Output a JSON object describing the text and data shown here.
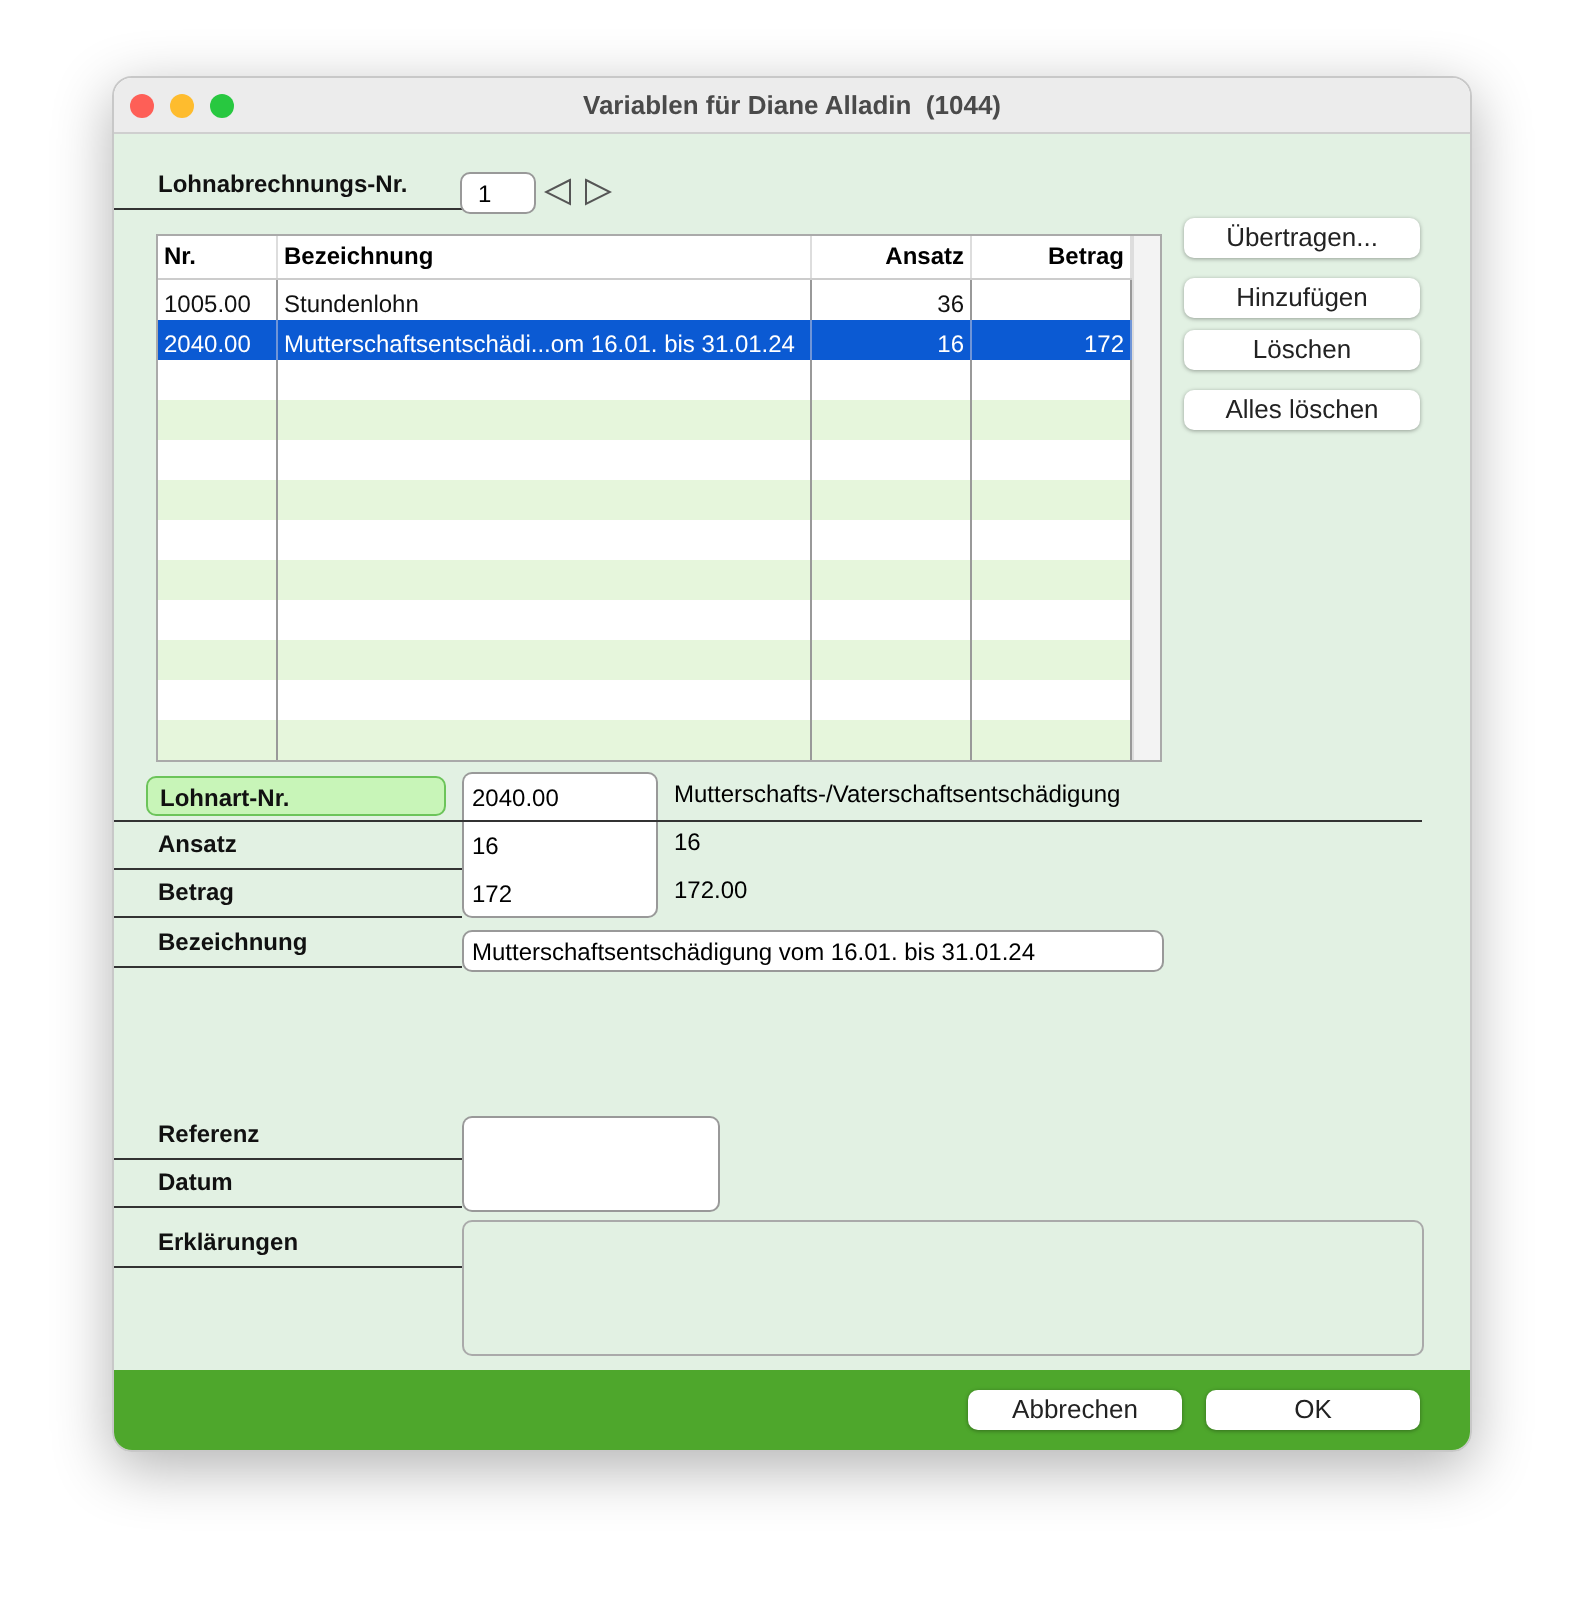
{
  "window": {
    "title": "Variablen für Diane Alladin  (1044)"
  },
  "payroll_number": {
    "label": "Lohnabrechnungs-Nr.",
    "value": "1"
  },
  "table": {
    "columns": [
      "Nr.",
      "Bezeichnung",
      "Ansatz",
      "Betrag"
    ],
    "rows": [
      {
        "cells": [
          "1005.00",
          "Stundenlohn",
          "36",
          ""
        ],
        "selected": false
      },
      {
        "cells": [
          "2040.00",
          "Mutterschaftsentschädi...om 16.01. bis 31.01.24",
          "16",
          "172"
        ],
        "selected": true
      }
    ]
  },
  "side_buttons": [
    "Übertragen...",
    "Hinzufügen",
    "Löschen",
    "Alles löschen"
  ],
  "detail": {
    "wage_type": {
      "label": "Lohnart-Nr.",
      "value": "2040.00",
      "description": "Mutterschafts-/Vaterschaftsentschädigung"
    },
    "rate": {
      "label": "Ansatz",
      "value": "16",
      "display": "16"
    },
    "amount": {
      "label": "Betrag",
      "value": "172",
      "display": "172.00"
    },
    "designation": {
      "label": "Bezeichnung",
      "value": "Mutterschaftsentschädigung vom 16.01. bis 31.01.24"
    },
    "reference": {
      "label": "Referenz"
    },
    "date": {
      "label": "Datum"
    },
    "explanations": {
      "label": "Erklärungen"
    }
  },
  "footer_buttons": [
    "Abbrechen",
    "OK"
  ]
}
